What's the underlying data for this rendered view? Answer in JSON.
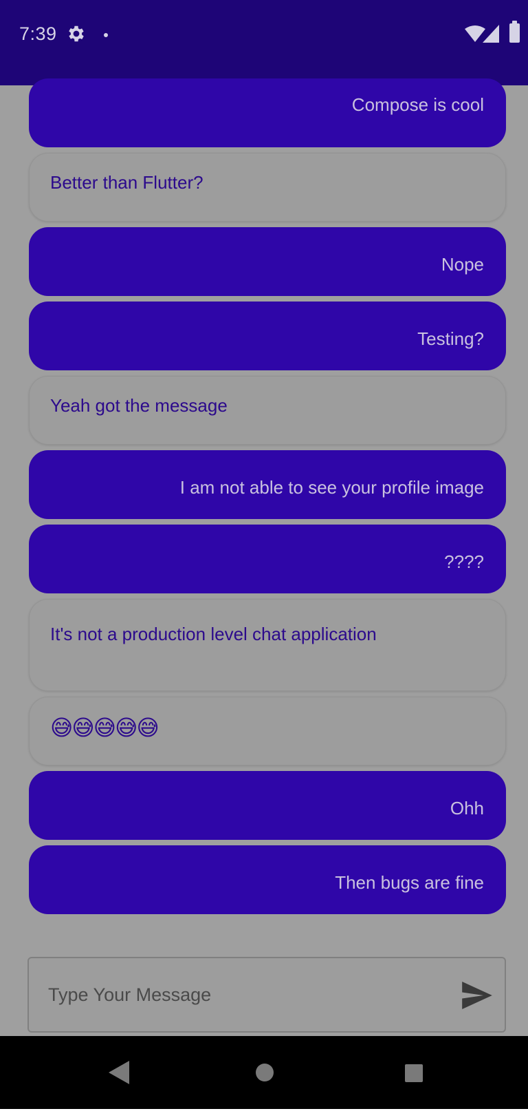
{
  "status_bar": {
    "time": "7:39",
    "icons": [
      "gear-icon",
      "notification-dot",
      "wifi-icon",
      "signal-icon",
      "battery-icon"
    ]
  },
  "messages": [
    {
      "direction": "sent",
      "text": "Compose is cool"
    },
    {
      "direction": "received",
      "text": "Better than Flutter?"
    },
    {
      "direction": "sent",
      "text": "Nope"
    },
    {
      "direction": "sent",
      "text": "Testing?"
    },
    {
      "direction": "received",
      "text": "Yeah got the message"
    },
    {
      "direction": "sent",
      "text": "I am not able to see your profile image"
    },
    {
      "direction": "sent",
      "text": "????"
    },
    {
      "direction": "received",
      "text": "It's not a production level chat application"
    },
    {
      "direction": "received",
      "text": "😅😅😅😅😅"
    },
    {
      "direction": "sent",
      "text": "Ohh"
    },
    {
      "direction": "sent",
      "text": "Then bugs are fine"
    }
  ],
  "input": {
    "placeholder": "Type Your Message",
    "value": "",
    "send_icon": "send-icon"
  },
  "nav_bar": {
    "icons": [
      "back-icon",
      "home-icon",
      "recents-icon"
    ]
  },
  "colors": {
    "status_bar": "#1e0577",
    "sent_bubble": "#2f06a8",
    "received_text": "#2c0a8c",
    "background": "#9f9f9f"
  }
}
